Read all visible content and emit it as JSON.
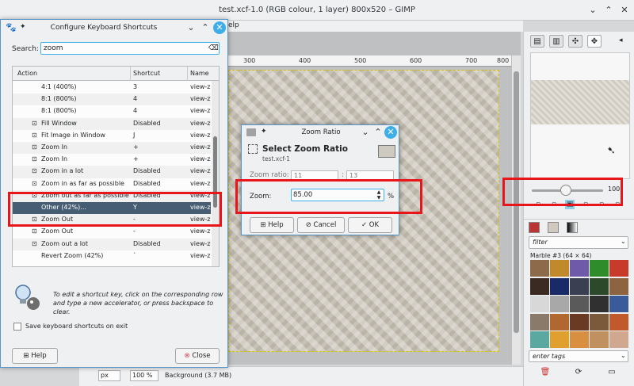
{
  "gimp": {
    "title": "test.xcf-1.0 (RGB colour, 1 layer) 800x520 – GIMP",
    "menu_visible": "elp",
    "ruler_marks": [
      "300",
      "400",
      "500",
      "600",
      "700",
      "800"
    ],
    "nav_zoom": "100",
    "filter_placeholder": "filter",
    "pattern_name": "Marble #3 (64 × 64)",
    "tags_placeholder": "enter tags",
    "statusbar_unit": "px",
    "statusbar_zoom": "100 %",
    "statusbar_layer": "Background (3.7 MB)"
  },
  "shortcuts": {
    "title": "Configure Keyboard Shortcuts",
    "search_label": "Search:",
    "search_value": "zoom",
    "columns": [
      "Action",
      "Shortcut",
      "Name"
    ],
    "rows": [
      {
        "action": "4:1  (400%)",
        "shortcut": "3",
        "name": "view-z",
        "icon": ""
      },
      {
        "action": "8:1  (800%)",
        "shortcut": "4",
        "name": "view-z",
        "icon": ""
      },
      {
        "action": "8:1  (800%)",
        "shortcut": "4",
        "name": "view-z",
        "icon": ""
      },
      {
        "action": "Fill Window",
        "shortcut": "Disabled",
        "name": "view-z",
        "icon": "zoom-fill-icon"
      },
      {
        "action": "Fit Image in Window",
        "shortcut": "J",
        "name": "view-z",
        "icon": "zoom-fit-icon"
      },
      {
        "action": "Zoom In",
        "shortcut": "+",
        "name": "view-z",
        "icon": "zoom-in-icon"
      },
      {
        "action": "Zoom In",
        "shortcut": "+",
        "name": "view-z",
        "icon": "zoom-in-icon"
      },
      {
        "action": "Zoom in a lot",
        "shortcut": "Disabled",
        "name": "view-z",
        "icon": "zoom-in-icon"
      },
      {
        "action": "Zoom in as far as possible",
        "shortcut": "Disabled",
        "name": "view-z",
        "icon": "zoom-in-icon"
      },
      {
        "action": "Zoom out as far as possible",
        "shortcut": "Disabled",
        "name": "view-z",
        "icon": "zoom-out-icon"
      },
      {
        "action": "Other (42%)...",
        "shortcut": "Y",
        "name": "view-z",
        "icon": ""
      },
      {
        "action": "Zoom Out",
        "shortcut": "-",
        "name": "view-z",
        "icon": "zoom-out-icon"
      },
      {
        "action": "Zoom Out",
        "shortcut": "-",
        "name": "view-z",
        "icon": "zoom-out-icon"
      },
      {
        "action": "Zoom out a lot",
        "shortcut": "Disabled",
        "name": "view-z",
        "icon": "zoom-out-icon"
      },
      {
        "action": "Revert Zoom (42%)",
        "shortcut": "`",
        "name": "view-z",
        "icon": ""
      }
    ],
    "selected_index": 10,
    "hint": "To edit a shortcut key, click on the corresponding row and type a new accelerator, or press backspace to clear.",
    "save_label": "Save keyboard shortcuts on exit",
    "help_label": "Help",
    "close_label": "Close"
  },
  "zoom_dialog": {
    "title": "Zoom Ratio",
    "heading": "Select Zoom Ratio",
    "subtitle": "test.xcf-1",
    "ratio_label": "Zoom ratio:",
    "ratio_a": "11",
    "ratio_b": "13",
    "zoom_label": "Zoom:",
    "zoom_value": "85.00",
    "unit": "%",
    "help_label": "Help",
    "cancel_label": "Cancel",
    "ok_label": "OK"
  },
  "colors": {
    "selection": "#475d73",
    "focus": "#3daee9",
    "highlight": "#e8161b",
    "close_button": "#da4453"
  }
}
